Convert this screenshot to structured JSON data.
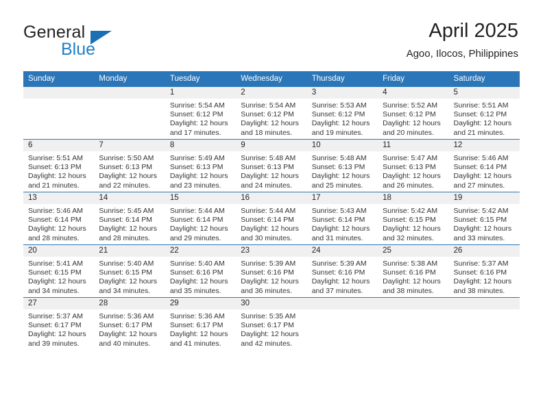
{
  "brand": {
    "word_one": "General",
    "word_two": "Blue",
    "triangle_icon": "triangle-logo-icon",
    "colors": {
      "blue": "#1f7fc4",
      "dark": "#231f20"
    }
  },
  "header": {
    "title": "April 2025",
    "subtitle": "Agoo, Ilocos, Philippines"
  },
  "theme": {
    "header_blue": "#2b76b8",
    "daynum_band": "#f0f0f0",
    "cell_bg": "#ffffff",
    "text": "#231f20"
  },
  "weekday_headers": [
    "Sunday",
    "Monday",
    "Tuesday",
    "Wednesday",
    "Thursday",
    "Friday",
    "Saturday"
  ],
  "labels": {
    "sunrise_prefix": "Sunrise:",
    "sunset_prefix": "Sunset:",
    "daylight_prefix": "Daylight:"
  },
  "weeks": [
    [
      {
        "day": "",
        "sunrise": "",
        "sunset": "",
        "daylight": ""
      },
      {
        "day": "",
        "sunrise": "",
        "sunset": "",
        "daylight": ""
      },
      {
        "day": "1",
        "sunrise": "Sunrise: 5:54 AM",
        "sunset": "Sunset: 6:12 PM",
        "daylight": "Daylight: 12 hours and 17 minutes."
      },
      {
        "day": "2",
        "sunrise": "Sunrise: 5:54 AM",
        "sunset": "Sunset: 6:12 PM",
        "daylight": "Daylight: 12 hours and 18 minutes."
      },
      {
        "day": "3",
        "sunrise": "Sunrise: 5:53 AM",
        "sunset": "Sunset: 6:12 PM",
        "daylight": "Daylight: 12 hours and 19 minutes."
      },
      {
        "day": "4",
        "sunrise": "Sunrise: 5:52 AM",
        "sunset": "Sunset: 6:12 PM",
        "daylight": "Daylight: 12 hours and 20 minutes."
      },
      {
        "day": "5",
        "sunrise": "Sunrise: 5:51 AM",
        "sunset": "Sunset: 6:12 PM",
        "daylight": "Daylight: 12 hours and 21 minutes."
      }
    ],
    [
      {
        "day": "6",
        "sunrise": "Sunrise: 5:51 AM",
        "sunset": "Sunset: 6:13 PM",
        "daylight": "Daylight: 12 hours and 21 minutes."
      },
      {
        "day": "7",
        "sunrise": "Sunrise: 5:50 AM",
        "sunset": "Sunset: 6:13 PM",
        "daylight": "Daylight: 12 hours and 22 minutes."
      },
      {
        "day": "8",
        "sunrise": "Sunrise: 5:49 AM",
        "sunset": "Sunset: 6:13 PM",
        "daylight": "Daylight: 12 hours and 23 minutes."
      },
      {
        "day": "9",
        "sunrise": "Sunrise: 5:48 AM",
        "sunset": "Sunset: 6:13 PM",
        "daylight": "Daylight: 12 hours and 24 minutes."
      },
      {
        "day": "10",
        "sunrise": "Sunrise: 5:48 AM",
        "sunset": "Sunset: 6:13 PM",
        "daylight": "Daylight: 12 hours and 25 minutes."
      },
      {
        "day": "11",
        "sunrise": "Sunrise: 5:47 AM",
        "sunset": "Sunset: 6:13 PM",
        "daylight": "Daylight: 12 hours and 26 minutes."
      },
      {
        "day": "12",
        "sunrise": "Sunrise: 5:46 AM",
        "sunset": "Sunset: 6:14 PM",
        "daylight": "Daylight: 12 hours and 27 minutes."
      }
    ],
    [
      {
        "day": "13",
        "sunrise": "Sunrise: 5:46 AM",
        "sunset": "Sunset: 6:14 PM",
        "daylight": "Daylight: 12 hours and 28 minutes."
      },
      {
        "day": "14",
        "sunrise": "Sunrise: 5:45 AM",
        "sunset": "Sunset: 6:14 PM",
        "daylight": "Daylight: 12 hours and 28 minutes."
      },
      {
        "day": "15",
        "sunrise": "Sunrise: 5:44 AM",
        "sunset": "Sunset: 6:14 PM",
        "daylight": "Daylight: 12 hours and 29 minutes."
      },
      {
        "day": "16",
        "sunrise": "Sunrise: 5:44 AM",
        "sunset": "Sunset: 6:14 PM",
        "daylight": "Daylight: 12 hours and 30 minutes."
      },
      {
        "day": "17",
        "sunrise": "Sunrise: 5:43 AM",
        "sunset": "Sunset: 6:14 PM",
        "daylight": "Daylight: 12 hours and 31 minutes."
      },
      {
        "day": "18",
        "sunrise": "Sunrise: 5:42 AM",
        "sunset": "Sunset: 6:15 PM",
        "daylight": "Daylight: 12 hours and 32 minutes."
      },
      {
        "day": "19",
        "sunrise": "Sunrise: 5:42 AM",
        "sunset": "Sunset: 6:15 PM",
        "daylight": "Daylight: 12 hours and 33 minutes."
      }
    ],
    [
      {
        "day": "20",
        "sunrise": "Sunrise: 5:41 AM",
        "sunset": "Sunset: 6:15 PM",
        "daylight": "Daylight: 12 hours and 34 minutes."
      },
      {
        "day": "21",
        "sunrise": "Sunrise: 5:40 AM",
        "sunset": "Sunset: 6:15 PM",
        "daylight": "Daylight: 12 hours and 34 minutes."
      },
      {
        "day": "22",
        "sunrise": "Sunrise: 5:40 AM",
        "sunset": "Sunset: 6:16 PM",
        "daylight": "Daylight: 12 hours and 35 minutes."
      },
      {
        "day": "23",
        "sunrise": "Sunrise: 5:39 AM",
        "sunset": "Sunset: 6:16 PM",
        "daylight": "Daylight: 12 hours and 36 minutes."
      },
      {
        "day": "24",
        "sunrise": "Sunrise: 5:39 AM",
        "sunset": "Sunset: 6:16 PM",
        "daylight": "Daylight: 12 hours and 37 minutes."
      },
      {
        "day": "25",
        "sunrise": "Sunrise: 5:38 AM",
        "sunset": "Sunset: 6:16 PM",
        "daylight": "Daylight: 12 hours and 38 minutes."
      },
      {
        "day": "26",
        "sunrise": "Sunrise: 5:37 AM",
        "sunset": "Sunset: 6:16 PM",
        "daylight": "Daylight: 12 hours and 38 minutes."
      }
    ],
    [
      {
        "day": "27",
        "sunrise": "Sunrise: 5:37 AM",
        "sunset": "Sunset: 6:17 PM",
        "daylight": "Daylight: 12 hours and 39 minutes."
      },
      {
        "day": "28",
        "sunrise": "Sunrise: 5:36 AM",
        "sunset": "Sunset: 6:17 PM",
        "daylight": "Daylight: 12 hours and 40 minutes."
      },
      {
        "day": "29",
        "sunrise": "Sunrise: 5:36 AM",
        "sunset": "Sunset: 6:17 PM",
        "daylight": "Daylight: 12 hours and 41 minutes."
      },
      {
        "day": "30",
        "sunrise": "Sunrise: 5:35 AM",
        "sunset": "Sunset: 6:17 PM",
        "daylight": "Daylight: 12 hours and 42 minutes."
      },
      {
        "day": "",
        "sunrise": "",
        "sunset": "",
        "daylight": ""
      },
      {
        "day": "",
        "sunrise": "",
        "sunset": "",
        "daylight": ""
      },
      {
        "day": "",
        "sunrise": "",
        "sunset": "",
        "daylight": ""
      }
    ]
  ]
}
